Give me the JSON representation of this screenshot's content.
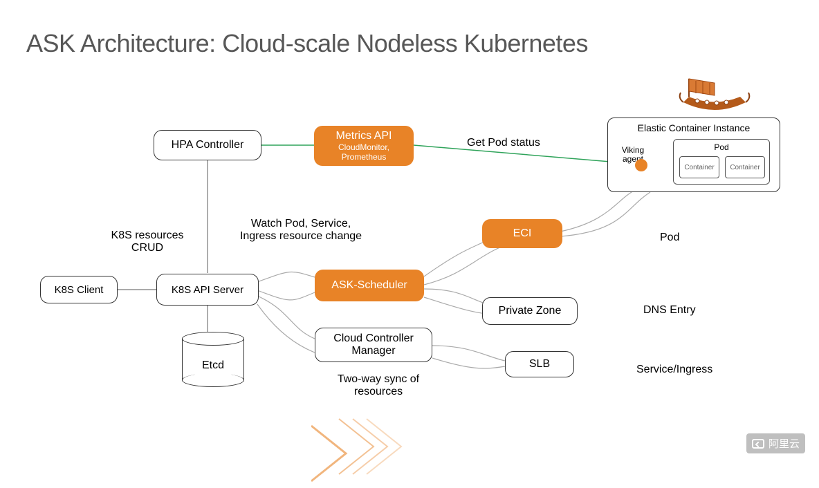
{
  "title": "ASK Architecture: Cloud-scale Nodeless Kubernetes",
  "nodes": {
    "hpa": "HPA Controller",
    "metrics": {
      "title": "Metrics API",
      "sub": "CloudMonitor,\nPrometheus"
    },
    "k8sClient": "K8S Client",
    "apiServer": "K8S API Server",
    "askSched": "ASK-Scheduler",
    "ccm": "Cloud Controller\nManager",
    "eci": "ECI",
    "pz": "Private Zone",
    "slb": "SLB",
    "etcd": "Etcd",
    "eciGroup": "Elastic Container Instance",
    "viking": "Viking\nagent",
    "pod": "Pod",
    "container": "Container"
  },
  "labels": {
    "getPod": "Get Pod status",
    "crud": "K8S resources\nCRUD",
    "watch": "Watch Pod, Service,\nIngress resource change",
    "twoway": "Two-way sync of\nresources",
    "podLbl": "Pod",
    "dns": "DNS Entry",
    "svc": "Service/Ingress"
  },
  "brand": "阿里云"
}
